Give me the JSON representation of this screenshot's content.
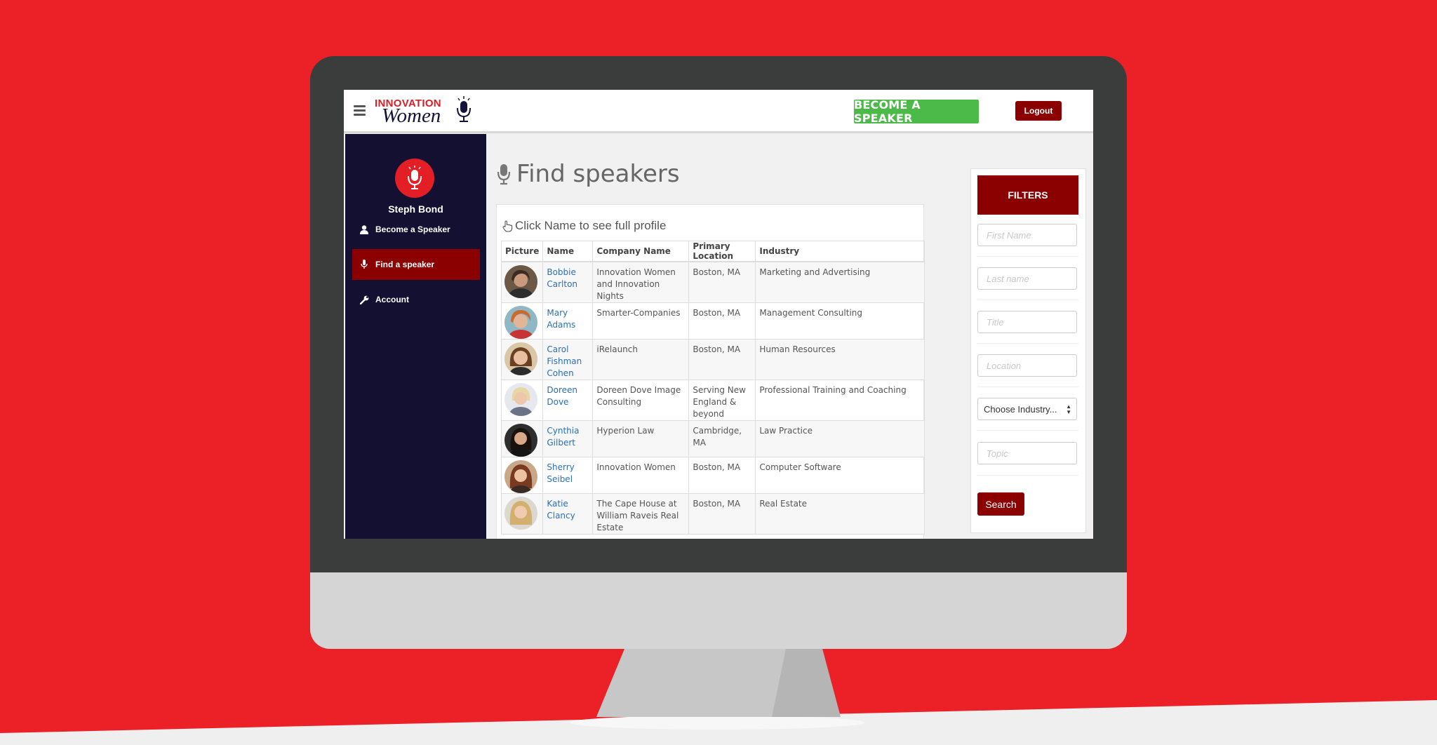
{
  "app": {
    "logo_top": "INNOVATION",
    "logo_bottom": "Women",
    "become_speaker": "BECOME A SPEAKER",
    "logout": "Logout"
  },
  "sidebar": {
    "user_name": "Steph Bond",
    "items": [
      {
        "label": "Become a Speaker",
        "icon": "user-icon"
      },
      {
        "label": "Find a speaker",
        "icon": "microphone-icon",
        "active": true
      },
      {
        "label": "Account",
        "icon": "wrench-icon"
      }
    ]
  },
  "main": {
    "title": "Find speakers",
    "hint": "Click Name to see full profile",
    "columns": [
      "Picture",
      "Name",
      "Company Name",
      "Primary Location",
      "Industry"
    ],
    "rows": [
      {
        "name": "Bobbie Carlton",
        "company": "Innovation Women and Innovation Nights",
        "location": "Boston, MA",
        "industry": "Marketing and Advertising"
      },
      {
        "name": "Mary Adams",
        "company": "Smarter-Companies",
        "location": "Boston, MA",
        "industry": "Management Consulting"
      },
      {
        "name": "Carol Fishman Cohen",
        "company": "iRelaunch",
        "location": "Boston, MA",
        "industry": "Human Resources"
      },
      {
        "name": "Doreen Dove",
        "company": "Doreen Dove Image Consulting",
        "location": "Serving New England & beyond",
        "industry": "Professional Training and Coaching"
      },
      {
        "name": "Cynthia Gilbert",
        "company": "Hyperion Law",
        "location": "Cambridge, MA",
        "industry": "Law Practice"
      },
      {
        "name": "Sherry Seibel",
        "company": "Innovation Women",
        "location": "Boston, MA",
        "industry": "Computer Software"
      },
      {
        "name": "Katie Clancy",
        "company": "The Cape House at William Raveis Real Estate",
        "location": "Boston, MA",
        "industry": "Real Estate"
      }
    ]
  },
  "filters": {
    "header": "FILTERS",
    "first_name_placeholder": "First Name",
    "last_name_placeholder": "Last name",
    "title_placeholder": "Title",
    "location_placeholder": "Location",
    "industry_select": "Choose Industry...",
    "topic_placeholder": "Topic",
    "search_button": "Search"
  },
  "colors": {
    "brand_red": "#ec2027",
    "dark_red": "#8b0000",
    "sidebar_navy": "#131032",
    "green": "#4cba49",
    "link_blue": "#2a6fb5"
  }
}
